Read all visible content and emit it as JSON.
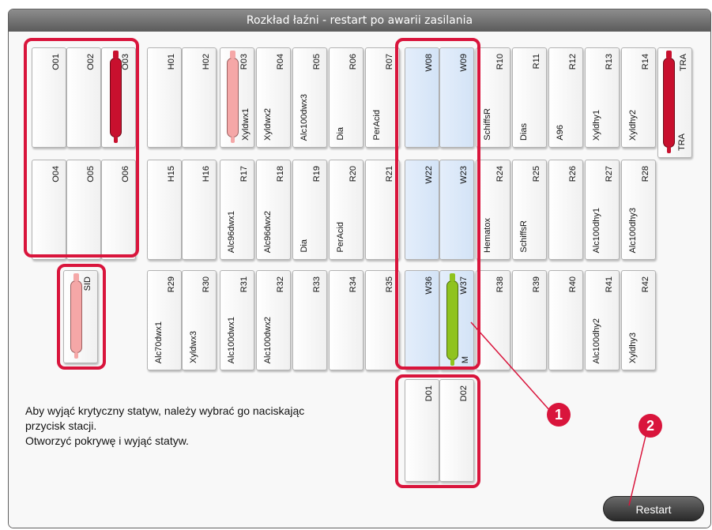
{
  "window": {
    "title": "Rozkład łaźni - restart po awarii zasilania"
  },
  "stations": {
    "O01": {
      "id": "O01"
    },
    "O02": {
      "id": "O02"
    },
    "O03": {
      "id": "O03"
    },
    "O04": {
      "id": "O04"
    },
    "O05": {
      "id": "O05"
    },
    "O06": {
      "id": "O06"
    },
    "SID": {
      "id": "SID"
    },
    "H01": {
      "id": "H01"
    },
    "H02": {
      "id": "H02"
    },
    "H15": {
      "id": "H15"
    },
    "H16": {
      "id": "H16"
    },
    "R03": {
      "id": "R03",
      "reagent": "Xyldwx1"
    },
    "R04": {
      "id": "R04",
      "reagent": "Xyldwx2"
    },
    "R05": {
      "id": "R05",
      "reagent": "Alc100dwx3"
    },
    "R06": {
      "id": "R06",
      "reagent": "Dia"
    },
    "R07": {
      "id": "R07",
      "reagent": "PerAcid"
    },
    "W08": {
      "id": "W08"
    },
    "W09": {
      "id": "W09"
    },
    "R10": {
      "id": "R10",
      "reagent": "SchiffsR"
    },
    "R11": {
      "id": "R11",
      "reagent": "Dias"
    },
    "R12": {
      "id": "R12",
      "reagent": "A96"
    },
    "R13": {
      "id": "R13",
      "reagent": "Xyldhy1"
    },
    "R14": {
      "id": "R14",
      "reagent": "Xyldhy2"
    },
    "TRA": {
      "id": "TRA",
      "reagent": "TRA"
    },
    "R17": {
      "id": "R17",
      "reagent": "Alc96dwx1"
    },
    "R18": {
      "id": "R18",
      "reagent": "Alc96dwx2"
    },
    "R19": {
      "id": "R19",
      "reagent": "Dia"
    },
    "R20": {
      "id": "R20",
      "reagent": "PerAcid"
    },
    "R21": {
      "id": "R21"
    },
    "W22": {
      "id": "W22"
    },
    "W23": {
      "id": "W23"
    },
    "R24": {
      "id": "R24",
      "reagent": "Hematox"
    },
    "R25": {
      "id": "R25",
      "reagent": "SchiffsR"
    },
    "R26": {
      "id": "R26"
    },
    "R27": {
      "id": "R27",
      "reagent": "Alc100dhy1"
    },
    "R28": {
      "id": "R28",
      "reagent": "Alc100dhy3"
    },
    "R29": {
      "id": "R29",
      "reagent": "Alc70dwx1"
    },
    "R30": {
      "id": "R30",
      "reagent": "Xyldwx3"
    },
    "R31": {
      "id": "R31",
      "reagent": "Alc100dwx1"
    },
    "R32": {
      "id": "R32",
      "reagent": "Alc100dwx2"
    },
    "R33": {
      "id": "R33"
    },
    "R34": {
      "id": "R34"
    },
    "R35": {
      "id": "R35"
    },
    "W36": {
      "id": "W36"
    },
    "W37": {
      "id": "W37",
      "reagent": "M"
    },
    "R38": {
      "id": "R38"
    },
    "R39": {
      "id": "R39"
    },
    "R40": {
      "id": "R40"
    },
    "R41": {
      "id": "R41",
      "reagent": "Alc100dhy2"
    },
    "R42": {
      "id": "R42",
      "reagent": "Xyldhy3"
    },
    "D01": {
      "id": "D01"
    },
    "D02": {
      "id": "D02"
    }
  },
  "message": {
    "line1": "Aby wyjąć krytyczny statyw, należy wybrać go naciskając",
    "line2": "przycisk stacji.",
    "line3": "Otworzyć pokrywę i wyjąć statyw."
  },
  "buttons": {
    "restart": "Restart"
  },
  "callouts": {
    "one": "1",
    "two": "2"
  },
  "colors": {
    "highlight": "#d9153c",
    "rack_red": "#c8102e",
    "rack_pink": "#f5a7a7",
    "rack_green": "#8fc31f",
    "water_station": "#dbe8f8",
    "callout": "#d9153c"
  }
}
